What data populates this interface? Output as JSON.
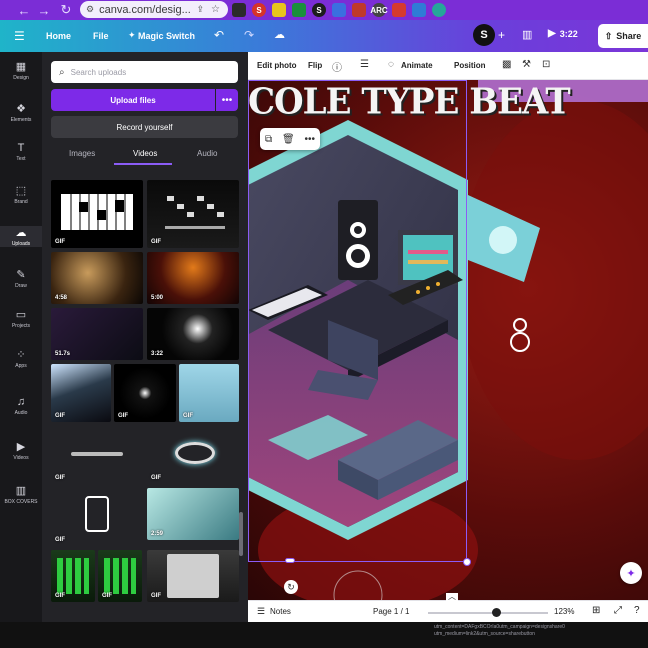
{
  "browser": {
    "url": "canva.com/desig...",
    "bookmarks": [
      {
        "name": "b1",
        "label": "",
        "color": "#2b2b2b"
      },
      {
        "name": "b2",
        "label": "S",
        "color": "#d6332a"
      },
      {
        "name": "b3",
        "label": "",
        "color": "#e8c51d"
      },
      {
        "name": "b4",
        "label": "",
        "color": "#1a8f3c"
      },
      {
        "name": "b5",
        "label": "S",
        "color": "#1d1d1d"
      },
      {
        "name": "b6",
        "label": "",
        "color": "#3b6fe0"
      },
      {
        "name": "b7",
        "label": "",
        "color": "#c0392b"
      },
      {
        "name": "b8",
        "label": "ARC",
        "color": "#444"
      },
      {
        "name": "b9",
        "label": "",
        "color": "#d63a2f"
      },
      {
        "name": "b10",
        "label": "",
        "color": "#2f7bd6"
      },
      {
        "name": "b11",
        "label": "",
        "color": "#26a69a"
      }
    ]
  },
  "header": {
    "home": "Home",
    "file": "File",
    "magic_switch": "Magic Switch",
    "duration": "3:22",
    "share": "Share"
  },
  "rail": [
    {
      "label": "Design",
      "icon": "▦"
    },
    {
      "label": "Elements",
      "icon": "❖"
    },
    {
      "label": "Text",
      "icon": "T"
    },
    {
      "label": "Brand",
      "icon": "⬚"
    },
    {
      "label": "Uploads",
      "icon": "☁"
    },
    {
      "label": "Draw",
      "icon": "✎"
    },
    {
      "label": "Projects",
      "icon": "▭"
    },
    {
      "label": "Apps",
      "icon": "⁘"
    },
    {
      "label": "Audio",
      "icon": "♫"
    },
    {
      "label": "Videos",
      "icon": "▶"
    },
    {
      "label": "BOX COVERS",
      "icon": "▥"
    }
  ],
  "panel": {
    "search_placeholder": "Search uploads",
    "upload_files": "Upload files",
    "record_yourself": "Record yourself",
    "tabs": {
      "images": "Images",
      "videos": "Videos",
      "audio": "Audio"
    },
    "thumbs": [
      "GIF",
      "GIF",
      "4:58",
      "5:00",
      "51.7s",
      "3:22",
      "GIF",
      "GIF",
      "GIF",
      "GIF",
      "GIF",
      "GIF",
      "2:59",
      "GIF",
      "GIF",
      "GIF"
    ]
  },
  "toolbar": {
    "edit_photo": "Edit photo",
    "flip": "Flip",
    "animate": "Animate",
    "position": "Position"
  },
  "canvas": {
    "title": "COLE TYPE BEAT"
  },
  "bottom": {
    "notes": "Notes",
    "page": "Page 1 / 1",
    "zoom": "123%",
    "zoom_level": 0.57
  },
  "status_url": "utm_content=DAFgxBCOrIa0utm_campaign=designshare0\nutm_medium=link2&utm_source=sharebutton"
}
